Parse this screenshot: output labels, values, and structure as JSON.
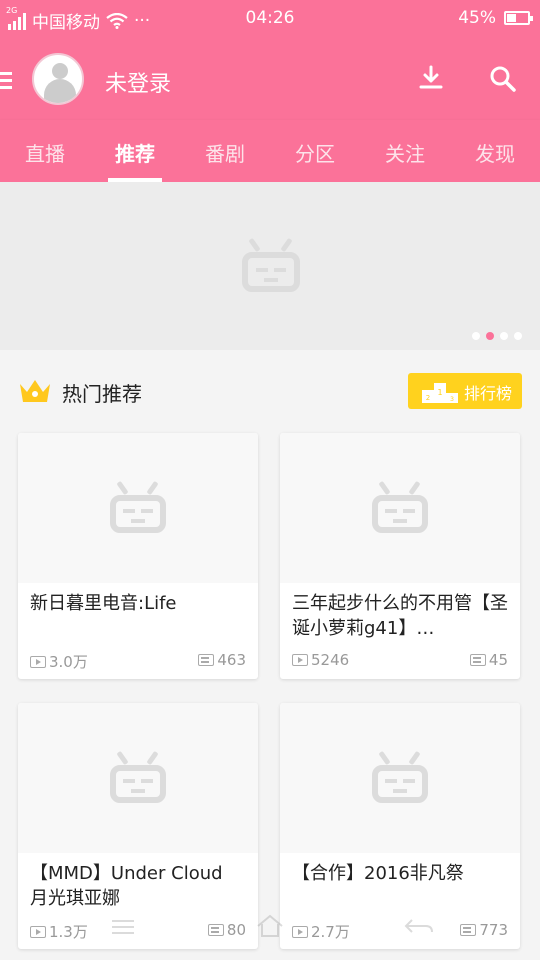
{
  "status_bar": {
    "carrier": "中国移动",
    "network": "2G",
    "more": "···",
    "time": "04:26",
    "battery": "45%",
    "battery_level": 0.45
  },
  "app_bar": {
    "menu_icon": "hamburger-icon",
    "avatar_icon": "default-avatar",
    "login_status": "未登录",
    "download_icon": "download-icon",
    "search_icon": "search-icon"
  },
  "tabs": [
    {
      "label": "直播",
      "active": false
    },
    {
      "label": "推荐",
      "active": true
    },
    {
      "label": "番剧",
      "active": false
    },
    {
      "label": "分区",
      "active": false
    },
    {
      "label": "关注",
      "active": false
    },
    {
      "label": "发现",
      "active": false
    }
  ],
  "banner": {
    "placeholder_icon": "tv-placeholder-icon",
    "page_count": 4,
    "active_page": 2
  },
  "section": {
    "title": "热门推荐",
    "icon": "crown-icon",
    "rank_button": "排行榜",
    "rank_icon": "podium-icon"
  },
  "videos": [
    {
      "title": "新日暮里电音:Life",
      "plays": "3.0万",
      "danmaku": "463"
    },
    {
      "title": "三年起步什么的不用管【圣诞小萝莉g41】…",
      "plays": "5246",
      "danmaku": "45"
    },
    {
      "title": "【MMD】Under Cloud 月光琪亚娜",
      "plays": "1.3万",
      "danmaku": "80"
    },
    {
      "title": "【合作】2016非凡祭",
      "plays": "2.7万",
      "danmaku": "773"
    }
  ],
  "colors": {
    "brand_pink": "#fb7299",
    "rank_yellow": "#ffd21e",
    "crown_yellow": "#ffc81e"
  }
}
